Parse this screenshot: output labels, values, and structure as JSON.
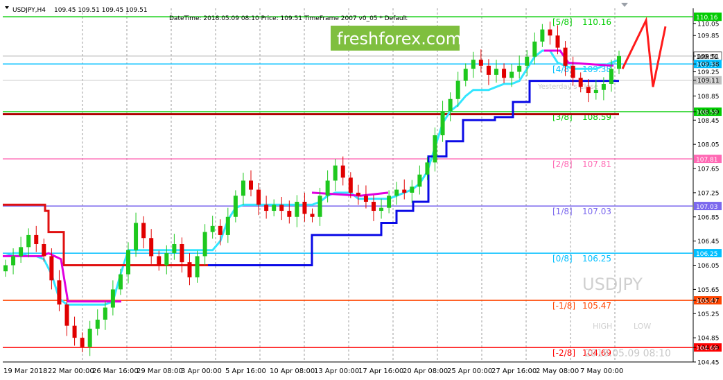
{
  "header": {
    "symbol_tf": "USDJPY,H4",
    "ohlc": "109.45 109.51 109.45 109.51",
    "indicator": "DateTime: 2018.05.09 08:10   Price: 109.51   TimeFrame 2007 v0_05  *  Default"
  },
  "watermark": {
    "brand": "freshforex.com",
    "symbol": "USDJPY",
    "high_label": "HIGH",
    "low_label": "LOW",
    "datetime": "2018.05.09 08:10",
    "yesterday_label": "Yesterday's Close"
  },
  "colors": {
    "bull": "#1ec81e",
    "bear": "#e00000",
    "cyan": "#33e6ff",
    "magenta": "#e000e0",
    "blue": "#0a0ae6",
    "red": "#e01010"
  },
  "chart_data": {
    "type": "candlestick",
    "symbol": "USDJPY",
    "timeframe": "H4",
    "ylim": [
      104.45,
      110.3
    ],
    "y_ticks": [
      "110.05",
      "109.85",
      "109.51",
      "109.38",
      "109.25",
      "109.11",
      "108.85",
      "108.59",
      "108.45",
      "108.05",
      "107.65",
      "107.25",
      "106.85",
      "106.45",
      "106.05",
      "105.65",
      "105.47",
      "105.25",
      "104.85",
      "104.69",
      "104.45"
    ],
    "x_ticks": [
      "19 Mar 2018",
      "22 Mar 00:00",
      "26 Mar 16:00",
      "29 Mar 08:00",
      "3 Apr 00:00",
      "5 Apr 16:00",
      "10 Apr 08:00",
      "13 Apr 00:00",
      "17 Apr 16:00",
      "20 Apr 08:00",
      "25 Apr 00:00",
      "27 Apr 16:00",
      "2 May 08:00",
      "7 May 00:00"
    ],
    "murrey_levels": [
      {
        "name": "[5/8]",
        "value": 110.16,
        "label": "110.16",
        "color": "#00cc00"
      },
      {
        "name": "[4/8]",
        "value": 109.38,
        "label": "109.38",
        "color": "#00bfff"
      },
      {
        "name": "[3/8]",
        "value": 108.59,
        "label": "108.59",
        "color": "#00cc00"
      },
      {
        "name": "[2/8]",
        "value": 107.81,
        "label": "107.81",
        "color": "#ff69b4"
      },
      {
        "name": "[1/8]",
        "value": 107.03,
        "label": "107.03",
        "color": "#7b68ee"
      },
      {
        "name": "[0/8]",
        "value": 106.25,
        "label": "106.25",
        "color": "#00bfff"
      },
      {
        "name": "[-1/8]",
        "value": 105.47,
        "label": "105.47",
        "color": "#ff4500"
      },
      {
        "name": "[-2/8]",
        "value": 104.69,
        "label": "104.69",
        "color": "#ff0000"
      }
    ],
    "price_tags": [
      {
        "value": 110.16,
        "label": "110.16",
        "color": "#00cc00"
      },
      {
        "value": 109.51,
        "label": "109.51",
        "color": "#ffffff",
        "text": "#000000"
      },
      {
        "value": 109.38,
        "label": "109.38",
        "color": "#00bfff"
      },
      {
        "value": 109.11,
        "label": "109.11",
        "color": "#c0c0c0"
      },
      {
        "value": 108.59,
        "label": "108.59",
        "color": "#00cc00"
      },
      {
        "value": 107.81,
        "label": "107.81",
        "color": "#ff69b4"
      },
      {
        "value": 107.03,
        "label": "107.03",
        "color": "#7b68ee"
      },
      {
        "value": 106.25,
        "label": "106.25",
        "color": "#00bfff"
      },
      {
        "value": 105.47,
        "label": "105.47",
        "color": "#ff4500"
      },
      {
        "value": 104.69,
        "label": "104.69",
        "color": "#ff0000"
      }
    ],
    "close_path": [
      106.05,
      106.2,
      106.35,
      106.55,
      106.4,
      106.2,
      105.8,
      105.4,
      105.05,
      104.85,
      104.7,
      105.0,
      105.15,
      105.35,
      105.65,
      105.9,
      106.3,
      106.75,
      106.5,
      106.2,
      106.05,
      106.25,
      106.4,
      106.1,
      105.85,
      106.2,
      106.6,
      106.7,
      106.55,
      106.85,
      107.2,
      107.45,
      107.3,
      107.05,
      106.95,
      107.05,
      106.95,
      106.85,
      107.1,
      106.9,
      106.85,
      107.2,
      107.45,
      107.7,
      107.5,
      107.25,
      107.2,
      107.1,
      106.95,
      107.0,
      107.2,
      107.3,
      107.25,
      107.35,
      107.55,
      107.75,
      108.2,
      108.6,
      108.8,
      109.1,
      109.3,
      109.45,
      109.35,
      109.2,
      109.3,
      109.15,
      109.25,
      109.35,
      109.5,
      109.75,
      109.95,
      109.85,
      109.65,
      109.35,
      109.15,
      109.0,
      108.9,
      108.95,
      109.05,
      109.3,
      109.51
    ],
    "cyan_line": [
      106.2,
      106.25,
      106.25,
      106.2,
      106.2,
      106.15,
      105.9,
      105.5,
      105.4,
      105.4,
      105.4,
      105.4,
      105.4,
      105.4,
      105.45,
      105.9,
      106.3,
      106.3,
      106.3,
      106.3,
      106.3,
      106.3,
      106.3,
      106.3,
      106.3,
      106.3,
      106.3,
      106.3,
      106.45,
      106.8,
      107.0,
      107.05,
      107.05,
      107.05,
      107.05,
      107.05,
      107.05,
      107.05,
      107.05,
      107.05,
      107.05,
      107.1,
      107.2,
      107.25,
      107.25,
      107.25,
      107.15,
      107.15,
      107.15,
      107.15,
      107.15,
      107.2,
      107.25,
      107.3,
      107.4,
      107.6,
      108.0,
      108.4,
      108.6,
      108.7,
      108.85,
      108.95,
      108.95,
      108.95,
      109.0,
      109.05,
      109.05,
      109.1,
      109.3,
      109.5,
      109.6,
      109.6,
      109.4,
      109.35,
      109.3,
      109.3,
      109.3,
      109.3,
      109.35,
      109.4,
      109.45
    ],
    "annotation": "Red zig-zag projection after last bar: up to 110.1, down to 109.0, up to 110.0"
  }
}
